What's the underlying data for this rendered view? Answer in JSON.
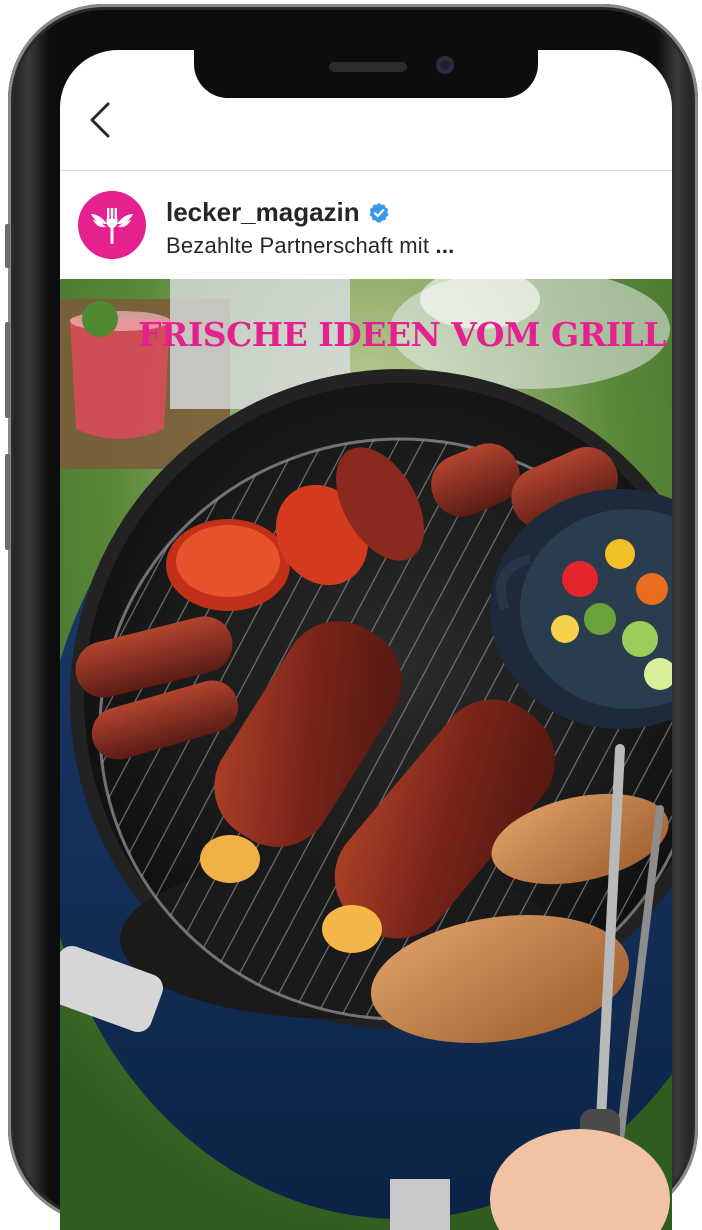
{
  "header": {
    "back_icon": "chevron-left-icon"
  },
  "post": {
    "username": "lecker_magazin",
    "verified_icon": "verified-badge-icon",
    "subtitle_prefix": "Bezahlte Partnerschaft mit ",
    "subtitle_partner": "...",
    "avatar_icon": "winged-fork-logo-icon",
    "brand_color": "#e4218f",
    "image_headline": "FRISCHE IDEEN VOM GRILL",
    "image_description_icon": "grill-photo"
  }
}
